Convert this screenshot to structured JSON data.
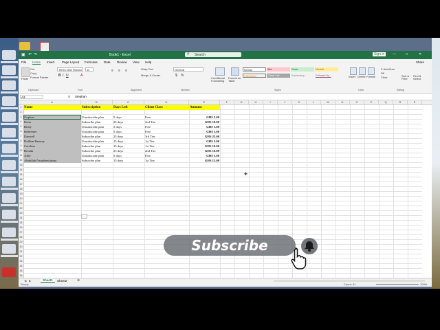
{
  "window": {
    "title": "Book1 - Excel",
    "search_placeholder": "Search",
    "signin": "Sign in"
  },
  "menu": [
    "File",
    "Home",
    "Insert",
    "Page Layout",
    "Formulas",
    "Data",
    "Review",
    "View",
    "Help"
  ],
  "share_label": "Share",
  "ribbon": {
    "paste": "Paste",
    "cut": "Cut",
    "copy": "Copy",
    "format_painter": "Format Painter",
    "font_name": "Times New Roman",
    "font_size": "11",
    "wrap_text": "Wrap Text",
    "merge_center": "Merge & Center",
    "number_format": "General",
    "conditional_formatting": "Conditional Formatting",
    "format_as_table": "Format as Table",
    "styles": {
      "normal": "Normal",
      "bad": "Bad",
      "good": "Good",
      "neutral": "Neutral",
      "calculation": "Calculation",
      "check_cell": "Check Cell",
      "explanatory": "Explanatory...",
      "followed": "Followed Hy..."
    },
    "insert": "Insert",
    "delete": "Delete",
    "format": "Format",
    "autosum": "AutoSum",
    "fill": "Fill",
    "clear": "Clear",
    "sort_filter": "Sort & Filter",
    "find_select": "Find & Select",
    "groups": {
      "clipboard": "Clipboard",
      "font": "Font",
      "alignment": "Alignment",
      "number": "Number",
      "styles": "Styles",
      "cells": "Cells",
      "editing": "Editing"
    }
  },
  "formula_bar": {
    "name_box": "A3",
    "fx": "fx",
    "content": "Stephan"
  },
  "columns": [
    "A",
    "B",
    "C",
    "D",
    "E",
    "F",
    "G",
    "H",
    "I",
    "J",
    "K",
    "L",
    "M",
    "N",
    "O",
    "P",
    "Q",
    "R",
    "S"
  ],
  "rows": [
    "1",
    "2",
    "3",
    "4",
    "5",
    "6",
    "7",
    "8",
    "9",
    "10",
    "11",
    "12",
    "13",
    "14",
    "15",
    "16",
    "17",
    "18",
    "19",
    "20",
    "21",
    "22",
    "23",
    "24",
    "25",
    "26",
    "27",
    "28",
    "29",
    "30",
    "31",
    "32",
    "33",
    "34",
    "35",
    "36",
    "37"
  ],
  "headers": [
    "Name",
    "Subscription",
    "Days Left",
    "Client Class",
    "Amount"
  ],
  "table": [
    [
      "Stephan",
      "Unsubscribe plan",
      "5 days",
      "Free",
      "GHS 5.00"
    ],
    [
      "Kenn",
      "Subscribe plan",
      "25 days",
      "2nd Tier",
      "GHS 18.00"
    ],
    [
      "Ricky",
      "Unsubscribe plan",
      "5 days",
      "Free",
      "GHS 5.00"
    ],
    [
      "Redeemer",
      "Unsubscribe plan",
      "5 days",
      "Free",
      "GHS 5.00"
    ],
    [
      "Danwell",
      "Subscribe plan",
      "25 days",
      "3rd Tier",
      "GHS 25.00"
    ],
    [
      "Daffkin Ramsey",
      "Unsubscribe plan",
      "15 days",
      "1st Tier",
      "GHS 5.00"
    ],
    [
      "Carolina",
      "Subscribe plan",
      "15 days",
      "1st Tier",
      "GHS 10.00"
    ],
    [
      "Brenda",
      "Subscribe plan",
      "25 days",
      "2nd Tier",
      "GHS 18.00"
    ],
    [
      "Affie",
      "Unsubscribe plan",
      "5 days",
      "Free",
      "GHS 5.00"
    ],
    [
      "Abdullah Naradeen bama",
      "Subscribe plan",
      "15 days",
      "1st Tier",
      "GHS 15.00"
    ]
  ],
  "sheets": [
    "Sheet1",
    "Sheet2"
  ],
  "status": {
    "ready": "Ready",
    "count": "Count: 31",
    "zoom": "100%"
  },
  "overlay": {
    "subscribe": "Subscribe"
  }
}
